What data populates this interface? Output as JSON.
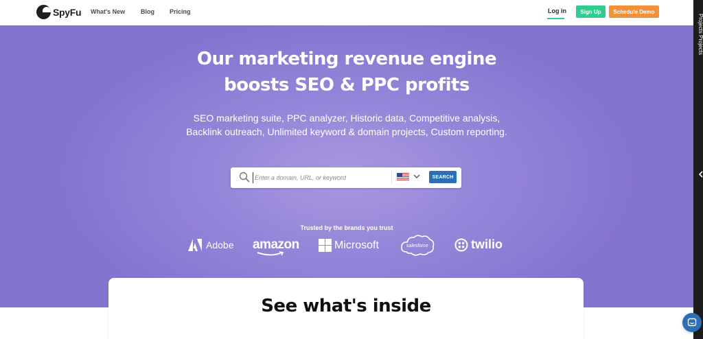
{
  "nav": {
    "logo_text": "SpyFu",
    "links": [
      "What's New",
      "Blog",
      "Pricing"
    ],
    "login": "Log in",
    "signup": "Sign Up",
    "demo": "Schedule Demo"
  },
  "hero": {
    "title_line1": "Our marketing revenue engine",
    "title_line2": "boosts SEO & PPC profits",
    "subtitle": "SEO marketing suite, PPC analyzer, Historic data, Competitive analysis, Backlink outreach, Unlimited keyword & domain projects, Custom reporting."
  },
  "search": {
    "placeholder": "Enter a domain, URL, or keyword",
    "country_icon": "us-flag-icon",
    "button": "SEARCH"
  },
  "trusted": {
    "heading": "Trusted by the brands you trust",
    "brands": [
      "Adobe",
      "amazon",
      "Microsoft",
      "salesforce",
      "twilio"
    ]
  },
  "card": {
    "title": "See what's inside"
  },
  "side_panel": {
    "label": "Projects Projects"
  },
  "colors": {
    "hero_bg": "#9383d8",
    "signup": "#2ecc8f",
    "demo": "#f2913a",
    "search_button": "#2c6fb5"
  }
}
